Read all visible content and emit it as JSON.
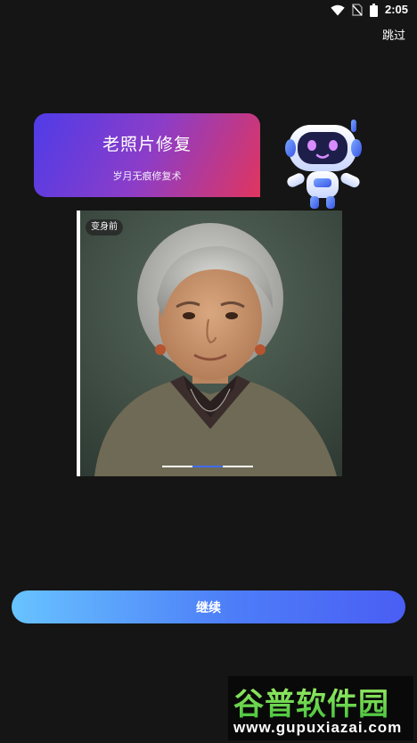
{
  "status_bar": {
    "time": "2:05",
    "icons": [
      "wifi-icon",
      "no-sim-icon",
      "battery-icon"
    ]
  },
  "header": {
    "skip_label": "跳过"
  },
  "banner": {
    "title": "老照片修复",
    "subtitle": "岁月无痕修复术",
    "gradient": [
      "#4f3ce8",
      "#e0355f"
    ]
  },
  "photo_compare": {
    "badge_label": "变身前",
    "indicator": {
      "count": 3,
      "active_index": 1
    }
  },
  "continue_button": {
    "label": "继续",
    "gradient": [
      "#68c3ff",
      "#4a5ef4"
    ]
  },
  "watermark": {
    "logo_text": "谷普软件园",
    "url": "www.gupuxiazai.com"
  },
  "colors": {
    "background": "#151515",
    "accent": "#3f6cff"
  }
}
